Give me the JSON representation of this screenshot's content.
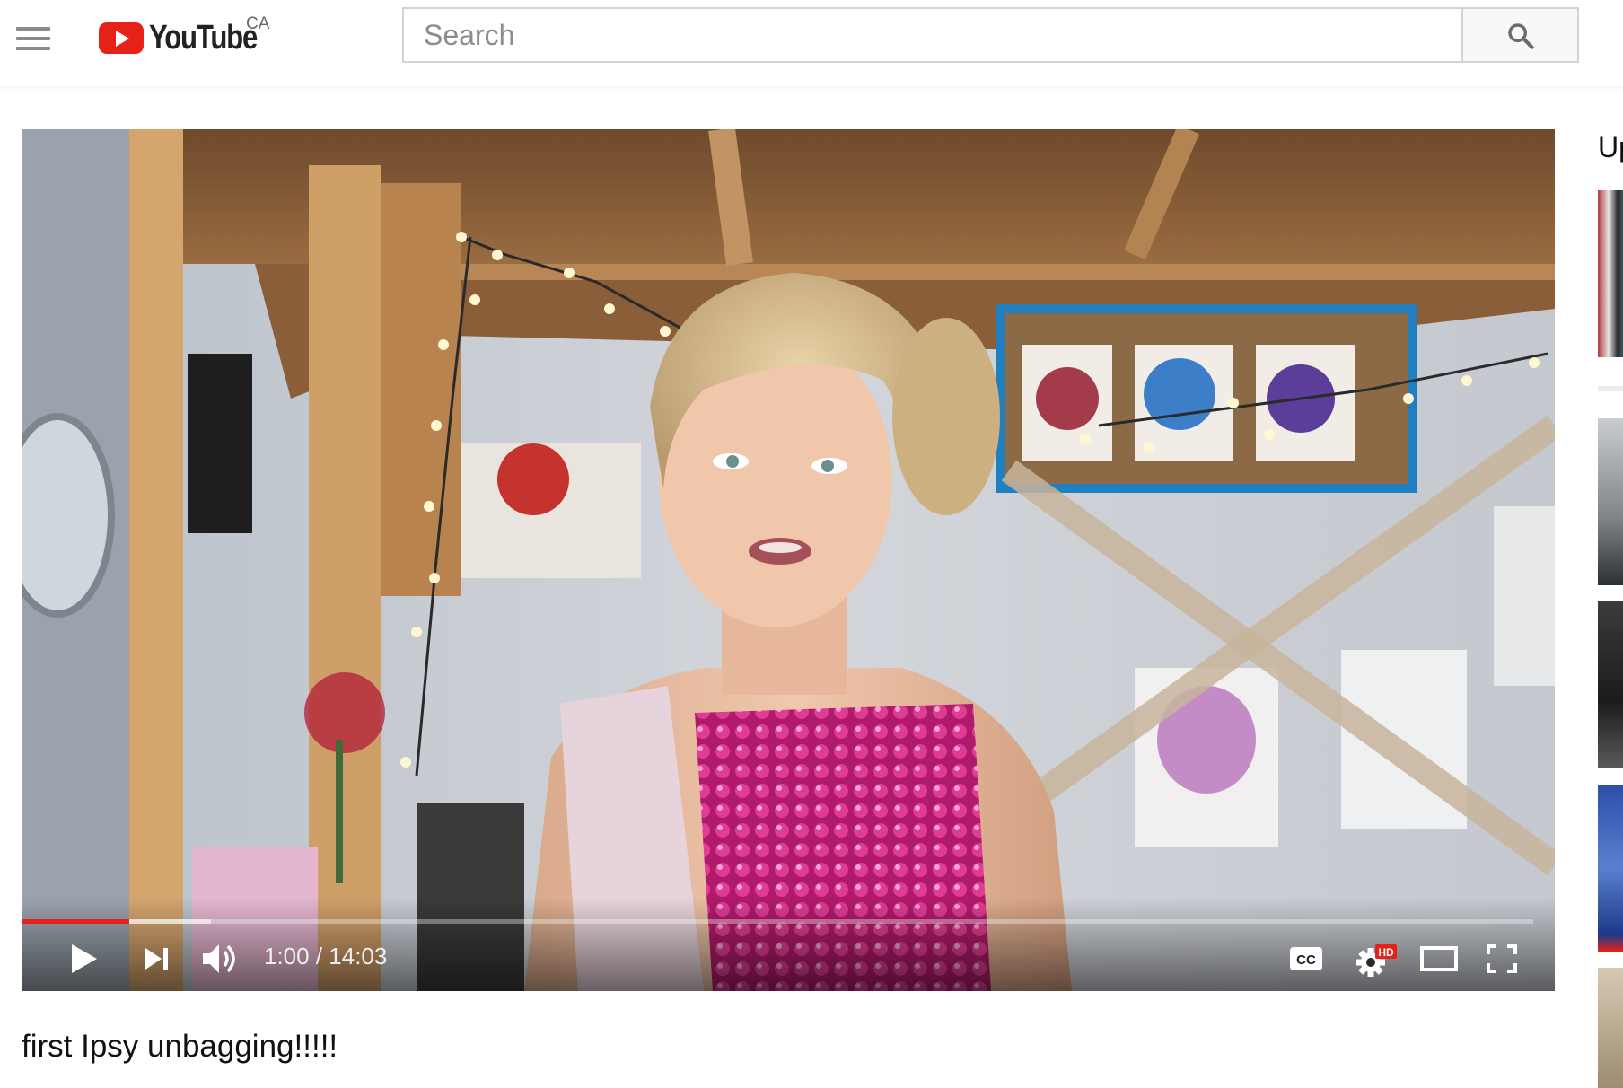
{
  "header": {
    "menu_icon": "hamburger-menu-icon",
    "logo_text": "YouTube",
    "country_code": "CA",
    "search": {
      "placeholder": "Search",
      "value": "",
      "button_icon": "search-icon"
    }
  },
  "player": {
    "current_time": "1:00",
    "duration": "14:03",
    "time_display": "1:00 / 14:03",
    "progress_fraction": 0.0712,
    "buffered_fraction": 0.125,
    "controls": {
      "play_icon": "play-icon",
      "next_icon": "next-icon",
      "volume_icon": "volume-icon",
      "captions_label": "CC",
      "settings_icon": "settings-gear-icon",
      "settings_badge": "HD",
      "theater_icon": "theater-mode-icon",
      "fullscreen_icon": "fullscreen-icon"
    },
    "accent_color": "#e62117"
  },
  "video": {
    "title": "first Ipsy unbagging!!!!!"
  },
  "sidebar": {
    "heading": "Up",
    "thumbnail_count_visible": 6
  }
}
